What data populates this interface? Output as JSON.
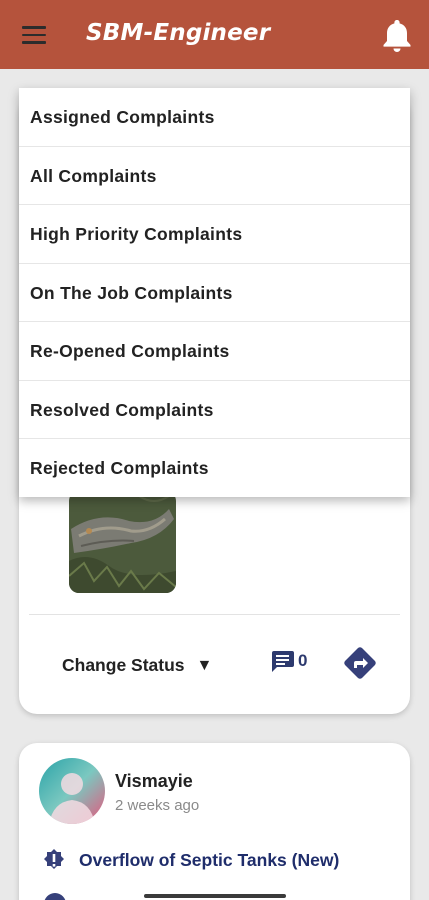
{
  "app_bar": {
    "title": "SBM-Engineer",
    "background": "#b5533c",
    "menu_icon": "hamburger-menu-icon",
    "bell_icon": "bell-icon"
  },
  "dropdown": {
    "items": [
      "Assigned Complaints",
      "All Complaints",
      "High Priority Complaints",
      "On The Job Complaints",
      "Re-Opened Complaints",
      "Resolved Complaints",
      "Rejected Complaints"
    ]
  },
  "card1": {
    "change_status_label": "Change Status",
    "caret": "▼",
    "comment_count": "0",
    "comment_icon": "comment-icon",
    "share_icon": "directions-icon"
  },
  "card2": {
    "user_name": "Vismayie",
    "time_ago": "2 weeks ago",
    "issue_title": "Overflow of Septic Tanks (New)",
    "accent": "#2d3a6e"
  }
}
